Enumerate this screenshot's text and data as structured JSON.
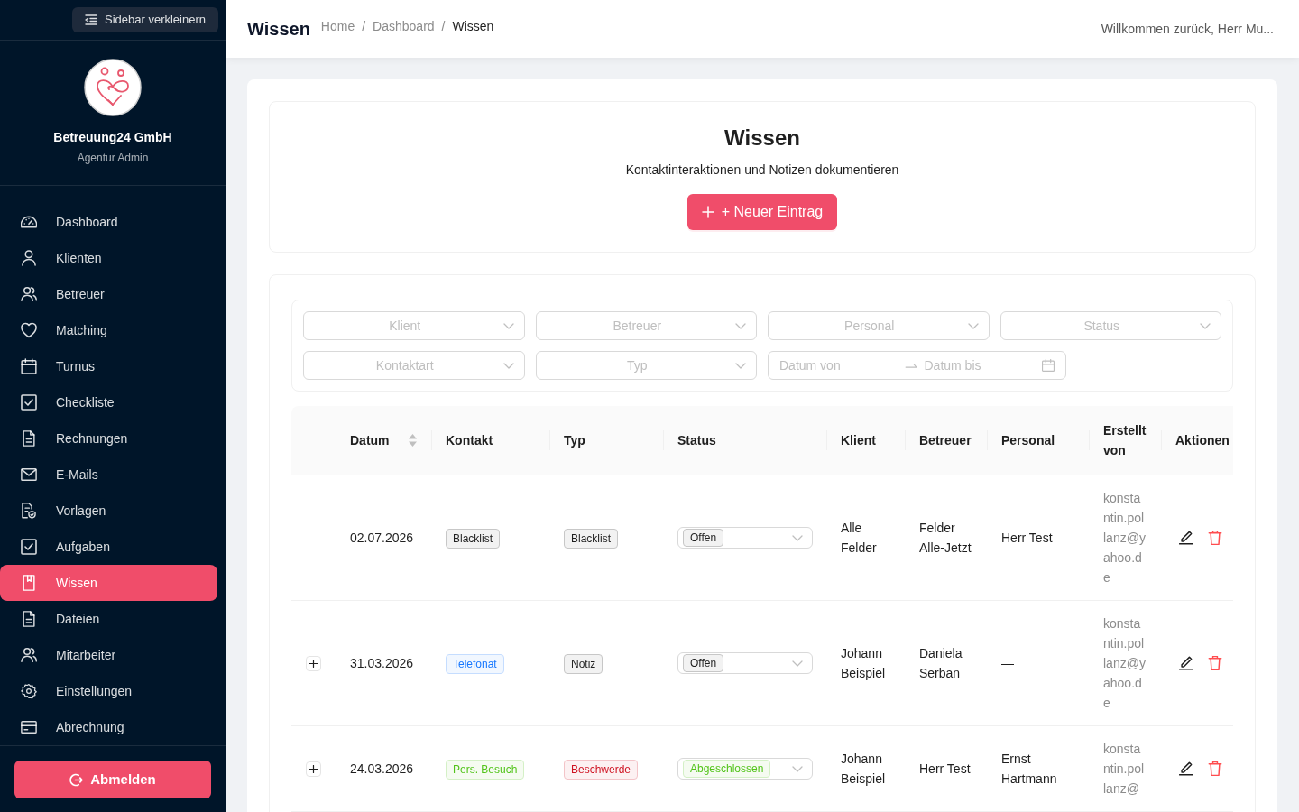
{
  "sidebar": {
    "collapse_button": {
      "label": "Sidebar verkleinern"
    },
    "company": {
      "name": "Betreuung24 GmbH",
      "role": "Agentur Admin"
    },
    "items": [
      {
        "label": "Dashboard",
        "selected": false
      },
      {
        "label": "Klienten",
        "selected": false
      },
      {
        "label": "Betreuer",
        "selected": false
      },
      {
        "label": "Matching",
        "selected": false
      },
      {
        "label": "Turnus",
        "selected": false
      },
      {
        "label": "Checkliste",
        "selected": false
      },
      {
        "label": "Rechnungen",
        "selected": false
      },
      {
        "label": "E-Mails",
        "selected": false
      },
      {
        "label": "Vorlagen",
        "selected": false
      },
      {
        "label": "Aufgaben",
        "selected": false
      },
      {
        "label": "Wissen",
        "selected": true
      },
      {
        "label": "Dateien",
        "selected": false
      },
      {
        "label": "Mitarbeiter",
        "selected": false
      },
      {
        "label": "Einstellungen",
        "selected": false
      },
      {
        "label": "Abrechnung",
        "selected": false
      }
    ],
    "logout_button": {
      "label": "Abmelden"
    }
  },
  "header": {
    "title": "Wissen",
    "breadcrumbs": [
      {
        "label": "Home",
        "current": false,
        "separator": "/"
      },
      {
        "label": "Dashboard",
        "current": false,
        "separator": "/"
      },
      {
        "label": "Wissen",
        "current": true
      }
    ],
    "welcome": "Willkommen zurück, Herr Mu..."
  },
  "intro": {
    "title": "Wissen",
    "subtitle": "Kontaktinteraktionen und Notizen dokumentieren",
    "new_button": {
      "label": "+ Neuer Eintrag"
    }
  },
  "filters": {
    "selects": [
      {
        "placeholder": "Klient"
      },
      {
        "placeholder": "Betreuer"
      },
      {
        "placeholder": "Personal"
      },
      {
        "placeholder": "Status"
      },
      {
        "placeholder": "Kontaktart"
      },
      {
        "placeholder": "Typ"
      }
    ],
    "date_range": {
      "from_placeholder": "Datum von",
      "to_placeholder": "Datum bis"
    }
  },
  "table": {
    "columns": [
      {
        "label": "Datum",
        "sortable": true
      },
      {
        "label": "Kontakt",
        "sortable": false
      },
      {
        "label": "Typ",
        "sortable": false
      },
      {
        "label": "Status",
        "sortable": false
      },
      {
        "label": "Klient",
        "sortable": false
      },
      {
        "label": "Betreuer",
        "sortable": false
      },
      {
        "label": "Personal",
        "sortable": false
      },
      {
        "label": "Erstellt von",
        "sortable": false
      },
      {
        "label": "Aktionen",
        "sortable": false
      }
    ],
    "rows": [
      {
        "expandable": false,
        "datum": "02.07.2026",
        "kontakt": {
          "label": "Blacklist",
          "color": "#1f1f1f"
        },
        "typ": {
          "label": "Blacklist",
          "color": "#1f1f1f"
        },
        "status": {
          "label": "Offen",
          "color": "#1f1f1f"
        },
        "klient": "Alle Felder",
        "betreuer": "Felder Alle-Jetzt",
        "personal": "Herr Test",
        "erstellt_von": "konstantin.pollanz@yahoo.de"
      },
      {
        "expandable": true,
        "datum": "31.03.2026",
        "kontakt": {
          "label": "Telefonat",
          "color": "#1677ff"
        },
        "typ": {
          "label": "Notiz",
          "color": "#1f1f1f"
        },
        "status": {
          "label": "Offen",
          "color": "#1f1f1f"
        },
        "klient": "Johann Beispiel",
        "betreuer": "Daniela Serban",
        "personal": "—",
        "erstellt_von": "konstantin.pollanz@yahoo.de"
      },
      {
        "expandable": true,
        "datum": "24.03.2026",
        "kontakt": {
          "label": "Pers. Besuch",
          "color": "#52c41a"
        },
        "typ": {
          "label": "Beschwerde",
          "color": "#cf1322"
        },
        "status": {
          "label": "Abgeschlossen",
          "color": "#52c41a"
        },
        "klient": "Johann Beispiel",
        "betreuer": "Herr Test",
        "personal": "Ernst Hartmann",
        "erstellt_von": "konstantin.pollanz@"
      }
    ]
  }
}
